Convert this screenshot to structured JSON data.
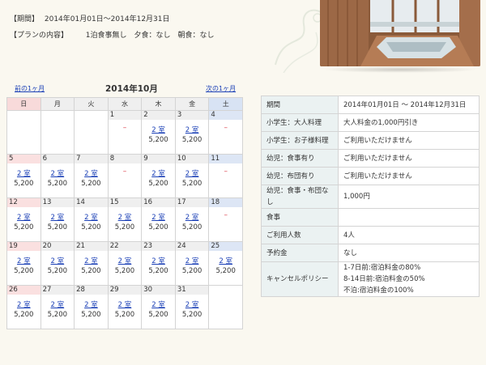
{
  "plan": {
    "period_label": "【期間】",
    "period_value": "2014年01月01日～2014年12月31日",
    "content_label": "【プランの内容】",
    "content_value": "1泊食事無し　夕食：なし　朝食：なし"
  },
  "calendar": {
    "prev": "前の1ヶ月",
    "next": "次の1ヶ月",
    "title": "2014年10月",
    "weekdays": [
      "日",
      "月",
      "火",
      "水",
      "木",
      "金",
      "土"
    ],
    "weeks": [
      [
        null,
        null,
        null,
        {
          "day": "1",
          "status": "–"
        },
        {
          "day": "2",
          "rooms": "2 室",
          "price": "5,200"
        },
        {
          "day": "3",
          "rooms": "2 室",
          "price": "5,200"
        },
        {
          "day": "4",
          "status": "–"
        }
      ],
      [
        {
          "day": "5",
          "rooms": "2 室",
          "price": "5,200"
        },
        {
          "day": "6",
          "rooms": "2 室",
          "price": "5,200"
        },
        {
          "day": "7",
          "rooms": "2 室",
          "price": "5,200"
        },
        {
          "day": "8",
          "status": "–"
        },
        {
          "day": "9",
          "rooms": "2 室",
          "price": "5,200"
        },
        {
          "day": "10",
          "rooms": "2 室",
          "price": "5,200"
        },
        {
          "day": "11",
          "status": "–"
        }
      ],
      [
        {
          "day": "12",
          "rooms": "2 室",
          "price": "5,200"
        },
        {
          "day": "13",
          "rooms": "2 室",
          "price": "5,200"
        },
        {
          "day": "14",
          "rooms": "2 室",
          "price": "5,200"
        },
        {
          "day": "15",
          "rooms": "2 室",
          "price": "5,200"
        },
        {
          "day": "16",
          "rooms": "2 室",
          "price": "5,200"
        },
        {
          "day": "17",
          "rooms": "2 室",
          "price": "5,200"
        },
        {
          "day": "18",
          "status": "–"
        }
      ],
      [
        {
          "day": "19",
          "rooms": "2 室",
          "price": "5,200"
        },
        {
          "day": "20",
          "rooms": "2 室",
          "price": "5,200"
        },
        {
          "day": "21",
          "rooms": "2 室",
          "price": "5,200"
        },
        {
          "day": "22",
          "rooms": "2 室",
          "price": "5,200"
        },
        {
          "day": "23",
          "rooms": "2 室",
          "price": "5,200"
        },
        {
          "day": "24",
          "rooms": "2 室",
          "price": "5,200"
        },
        {
          "day": "25",
          "rooms": "2 室",
          "price": "5,200"
        }
      ],
      [
        {
          "day": "26",
          "rooms": "2 室",
          "price": "5,200"
        },
        {
          "day": "27",
          "rooms": "2 室",
          "price": "5,200"
        },
        {
          "day": "28",
          "rooms": "2 室",
          "price": "5,200"
        },
        {
          "day": "29",
          "rooms": "2 室",
          "price": "5,200"
        },
        {
          "day": "30",
          "rooms": "2 室",
          "price": "5,200"
        },
        {
          "day": "31",
          "rooms": "2 室",
          "price": "5,200"
        },
        null
      ]
    ]
  },
  "details": [
    {
      "label": "期間",
      "value": "2014年01月01日 ～ 2014年12月31日"
    },
    {
      "label": "小学生：大人料理",
      "value": "大人料金の1,000円引き"
    },
    {
      "label": "小学生：お子様料理",
      "value": "ご利用いただけません"
    },
    {
      "label": "幼児：食事有り",
      "value": "ご利用いただけません"
    },
    {
      "label": "幼児：布団有り",
      "value": "ご利用いただけません"
    },
    {
      "label": "幼児：食事・布団なし",
      "value": "1,000円"
    },
    {
      "label": "食事",
      "value": ""
    },
    {
      "label": "ご利用人数",
      "value": "4人"
    },
    {
      "label": "予約金",
      "value": "なし"
    },
    {
      "label": "キャンセルポリシー",
      "value": "1-7日前:宿泊料金の80%\n8-14日前:宿泊料金の50%\n不泊:宿泊料金の100%"
    }
  ],
  "colors": {
    "link": "#1a3fb6",
    "unavailable": "#d9333f",
    "detail_label_bg": "#ebf2f2",
    "sunday_bg": "#f8dada",
    "saturday_bg": "#d8e3f4"
  }
}
